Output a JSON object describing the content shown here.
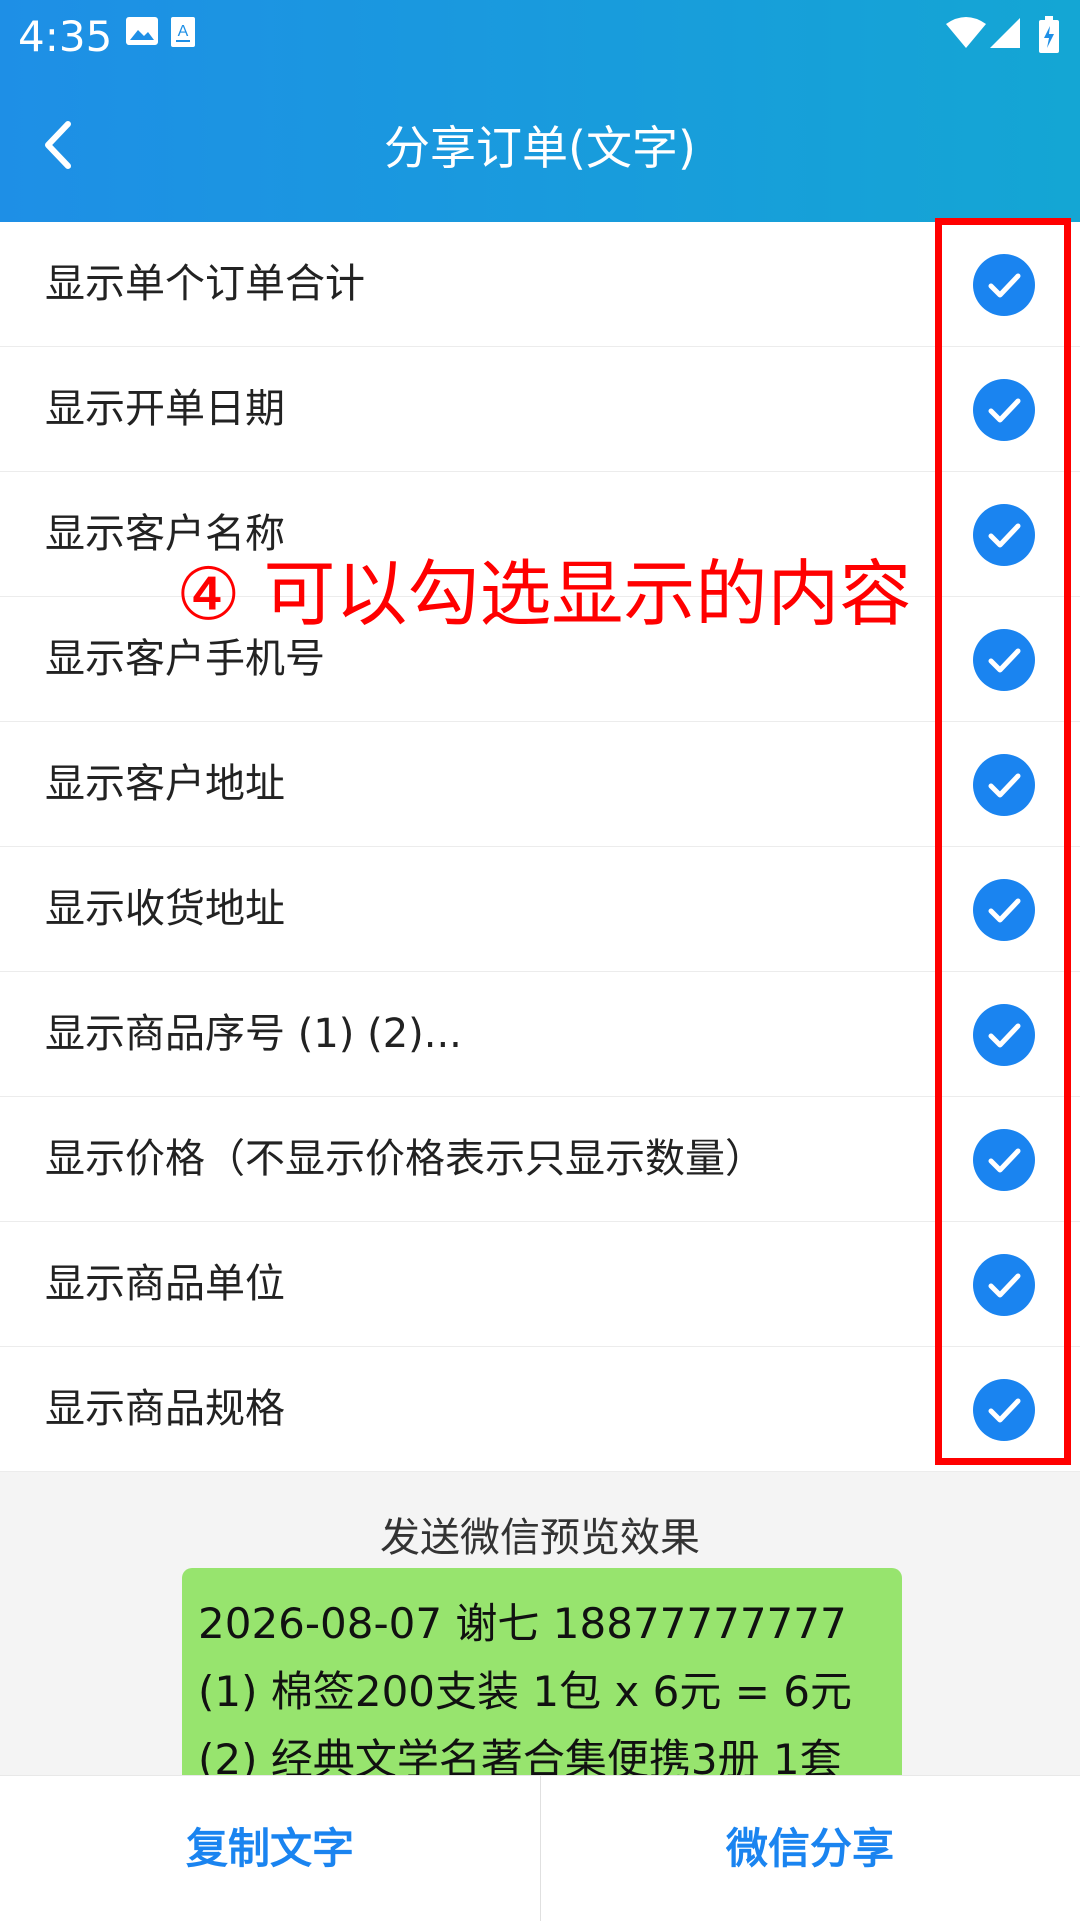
{
  "status_bar": {
    "time": "4:35",
    "icons": [
      "image-icon",
      "a-download-icon",
      "wifi-icon",
      "signal-icon",
      "battery-icon"
    ]
  },
  "header": {
    "title": "分享订单(文字)",
    "back_icon": "back-arrow-icon"
  },
  "options": [
    {
      "label": "显示单个订单合计",
      "checked": true
    },
    {
      "label": "显示开单日期",
      "checked": true
    },
    {
      "label": "显示客户名称",
      "checked": true
    },
    {
      "label": "显示客户手机号",
      "checked": true
    },
    {
      "label": "显示客户地址",
      "checked": true
    },
    {
      "label": "显示收货地址",
      "checked": true
    },
    {
      "label": "显示商品序号 (1) (2)...",
      "checked": true
    },
    {
      "label": "显示价格（不显示价格表示只显示数量）",
      "checked": true
    },
    {
      "label": "显示商品单位",
      "checked": true
    },
    {
      "label": "显示商品规格",
      "checked": true
    }
  ],
  "annotation": "④ 可以勾选显示的内容",
  "preview": {
    "title": "发送微信预览效果",
    "lines": [
      "2026-08-07 谢七 18877777777",
      "(1) 棉签200支装 1包 x 6元 = 6元",
      "(2) 经典文学名著合集便携3册 1套"
    ]
  },
  "bottom_bar": {
    "copy_label": "复制文字",
    "wechat_label": "微信分享"
  },
  "colors": {
    "header_start": "#1e8fe6",
    "header_end": "#14a6d4",
    "accent": "#1a84f0",
    "annotation": "#ff0000",
    "bubble": "#97e46e"
  }
}
